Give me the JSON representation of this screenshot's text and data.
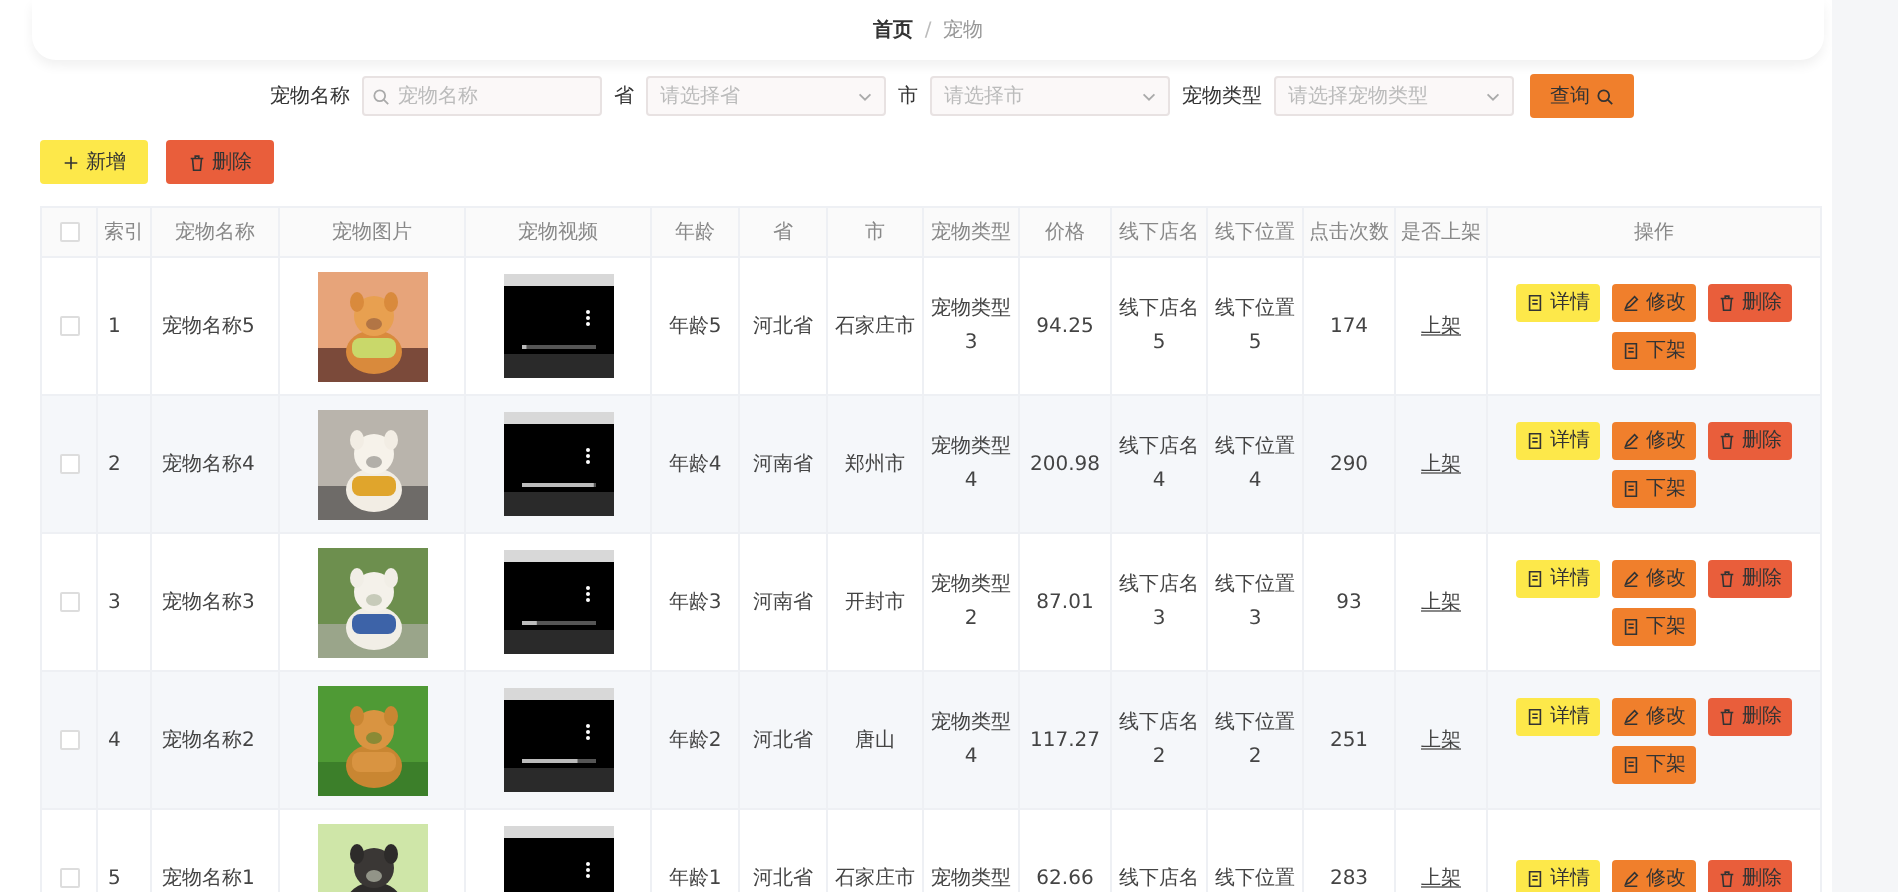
{
  "breadcrumb": {
    "items": [
      {
        "label": "首页",
        "selected": false
      },
      {
        "label": "宠物",
        "selected": true
      }
    ],
    "separator": "/"
  },
  "search": {
    "fields": [
      {
        "kind": "input",
        "label": "宠物名称",
        "placeholder": "宠物名称"
      },
      {
        "kind": "select",
        "label": "省",
        "placeholder": "请选择省"
      },
      {
        "kind": "select",
        "label": "市",
        "placeholder": "请选择市"
      },
      {
        "kind": "select",
        "label": "宠物类型",
        "placeholder": "请选择宠物类型"
      }
    ],
    "button": "查询"
  },
  "toolbar": [
    {
      "kind": "add",
      "label": "新增"
    },
    {
      "kind": "delete",
      "label": "删除"
    }
  ],
  "table": {
    "header_checked": false,
    "columns": [
      "索引",
      "宠物名称",
      "宠物图片",
      "宠物视频",
      "年龄",
      "省",
      "市",
      "宠物类型",
      "价格",
      "线下店名",
      "线下位置",
      "点击次数",
      "是否上架",
      "操作"
    ],
    "rows": [
      {
        "checked": false,
        "index": "1",
        "name": "宠物名称5",
        "video": {
          "level": 0.06
        },
        "age": "年龄5",
        "province": "河北省",
        "city": "石家庄市",
        "type": "宠物类型3",
        "price": "94.25",
        "shop": "线下店名5",
        "location": "线下位置5",
        "clicks": "174",
        "listed": "上架",
        "actions": [
          {
            "kind": "detail",
            "label": "详情"
          },
          {
            "kind": "edit",
            "label": "修改"
          },
          {
            "kind": "delete",
            "label": "删除"
          },
          {
            "kind": "offshelf",
            "label": "下架"
          }
        ]
      },
      {
        "checked": false,
        "index": "2",
        "name": "宠物名称4",
        "video": {
          "level": 0.97
        },
        "age": "年龄4",
        "province": "河南省",
        "city": "郑州市",
        "type": "宠物类型4",
        "price": "200.98",
        "shop": "线下店名4",
        "location": "线下位置4",
        "clicks": "290",
        "listed": "上架",
        "actions": [
          {
            "kind": "detail",
            "label": "详情"
          },
          {
            "kind": "edit",
            "label": "修改"
          },
          {
            "kind": "delete",
            "label": "删除"
          },
          {
            "kind": "offshelf",
            "label": "下架"
          }
        ]
      },
      {
        "checked": false,
        "index": "3",
        "name": "宠物名称3",
        "video": {
          "level": 0.2
        },
        "age": "年龄3",
        "province": "河南省",
        "city": "开封市",
        "type": "宠物类型2",
        "price": "87.01",
        "shop": "线下店名3",
        "location": "线下位置3",
        "clicks": "93",
        "listed": "上架",
        "actions": [
          {
            "kind": "detail",
            "label": "详情"
          },
          {
            "kind": "edit",
            "label": "修改"
          },
          {
            "kind": "delete",
            "label": "删除"
          },
          {
            "kind": "offshelf",
            "label": "下架"
          }
        ]
      },
      {
        "checked": false,
        "index": "4",
        "name": "宠物名称2",
        "video": {
          "level": 0.75
        },
        "age": "年龄2",
        "province": "河北省",
        "city": "唐山",
        "type": "宠物类型4",
        "price": "117.27",
        "shop": "线下店名2",
        "location": "线下位置2",
        "clicks": "251",
        "listed": "上架",
        "actions": [
          {
            "kind": "detail",
            "label": "详情"
          },
          {
            "kind": "edit",
            "label": "修改"
          },
          {
            "kind": "delete",
            "label": "删除"
          },
          {
            "kind": "offshelf",
            "label": "下架"
          }
        ]
      },
      {
        "checked": false,
        "index": "5",
        "name": "宠物名称1",
        "age": "年龄1",
        "province": "河北省",
        "city": "石家庄市",
        "type": "宠物类型",
        "price": "62.66",
        "shop": "线下店名",
        "location": "线下位置",
        "clicks": "283",
        "listed": "上架",
        "actions": [
          {
            "kind": "detail",
            "label": "详情"
          },
          {
            "kind": "edit",
            "label": "修改"
          },
          {
            "kind": "delete",
            "label": "删除"
          }
        ]
      }
    ]
  }
}
